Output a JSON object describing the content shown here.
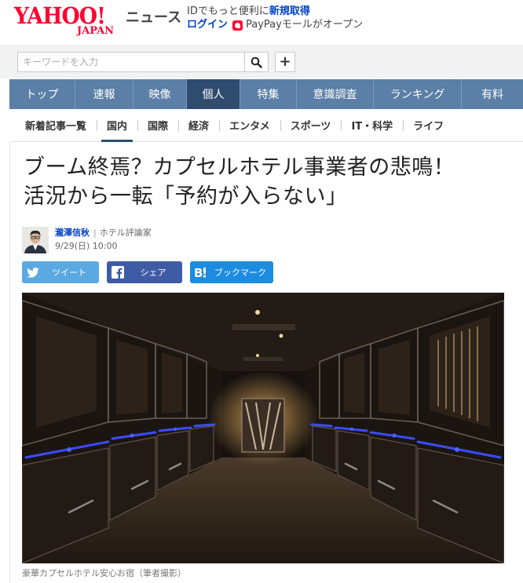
{
  "header": {
    "logo_main": "YAHOO!",
    "logo_sub": "JAPAN",
    "service_name": "ニュース",
    "promo_text": "IDでもっと便利に",
    "promo_signup": "新規取得",
    "login": "ログイン",
    "paypay_text": "PayPayモールがオープン"
  },
  "search": {
    "placeholder": "キーワードを入力",
    "add_label": "+"
  },
  "main_nav": [
    {
      "label": "トップ",
      "active": false
    },
    {
      "label": "速報",
      "active": false
    },
    {
      "label": "映像",
      "active": false
    },
    {
      "label": "個人",
      "active": true
    },
    {
      "label": "特集",
      "active": false
    },
    {
      "label": "意識調査",
      "active": false
    },
    {
      "label": "ランキング",
      "active": false
    },
    {
      "label": "有料",
      "active": false
    }
  ],
  "sub_nav": [
    {
      "label": "新着記事一覧",
      "active": false
    },
    {
      "label": "国内",
      "active": true
    },
    {
      "label": "国際",
      "active": false
    },
    {
      "label": "経済",
      "active": false
    },
    {
      "label": "エンタメ",
      "active": false
    },
    {
      "label": "スポーツ",
      "active": false
    },
    {
      "label": "IT・科学",
      "active": false
    },
    {
      "label": "ライフ",
      "active": false
    }
  ],
  "article": {
    "headline_line1": "ブーム終焉？カプセルホテル事業者の悲鳴！",
    "headline_line2": "活況から一転「予約が入らない」",
    "author_name": "瀧澤信秋",
    "author_role": "ホテル評論家",
    "date": "9/29(日) 10:00",
    "share": {
      "twitter": "ツイート",
      "facebook": "シェア",
      "hatena": "ブックマーク"
    },
    "photo_caption": "豪華カプセルホテル安心お宿（筆者撮影）"
  },
  "colors": {
    "brand_red": "#ff0033",
    "nav_blue": "#5b7fa6",
    "nav_active": "#2f4c6e",
    "link_blue": "#0041c9",
    "twitter": "#5aa9e2",
    "facebook": "#3e5ba6",
    "hatena": "#1b8ce0"
  },
  "icons": [
    "search-icon",
    "plus-icon",
    "paypay-icon",
    "twitter-icon",
    "facebook-icon",
    "hatena-bookmark-icon"
  ]
}
